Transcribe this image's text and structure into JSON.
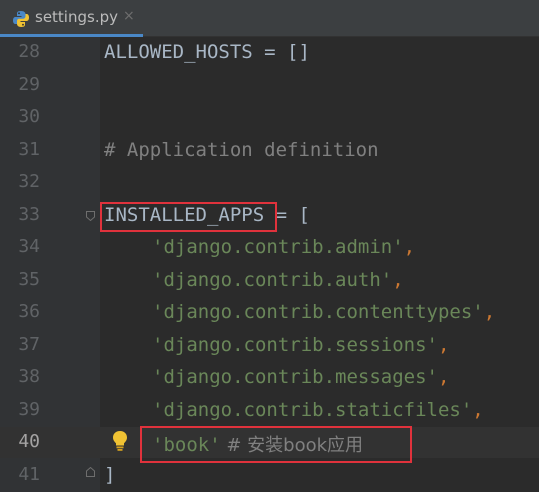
{
  "tab": {
    "filename": "settings.py",
    "close_glyph": "×",
    "icon": "python-file-icon"
  },
  "colors": {
    "editor_bg": "#2b2b2b",
    "gutter_bg": "#313335",
    "string": "#6a8759",
    "comment": "#808080",
    "punctuation": "#cc7832",
    "highlight_box": "#e0323c",
    "tab_underline": "#4a88c7"
  },
  "lines": [
    {
      "number": "28",
      "code": "ALLOWED_HOSTS = []"
    },
    {
      "number": "29",
      "code": ""
    },
    {
      "number": "30",
      "code": ""
    },
    {
      "number": "31",
      "code": "# Application definition"
    },
    {
      "number": "32",
      "code": ""
    },
    {
      "number": "33",
      "name": "INSTALLED_APPS",
      "rest": " = ["
    },
    {
      "number": "34",
      "string": "'django.contrib.admin'",
      "punc": ","
    },
    {
      "number": "35",
      "string": "'django.contrib.auth'",
      "punc": ","
    },
    {
      "number": "36",
      "string": "'django.contrib.contenttypes'",
      "punc": ","
    },
    {
      "number": "37",
      "string": "'django.contrib.sessions'",
      "punc": ","
    },
    {
      "number": "38",
      "string": "'django.contrib.messages'",
      "punc": ","
    },
    {
      "number": "39",
      "string": "'django.contrib.staticfiles'",
      "punc": ","
    },
    {
      "number": "40",
      "string": "'book'",
      "comment": " # 安装book应用"
    },
    {
      "number": "41",
      "code": "]"
    }
  ],
  "current_line": "40"
}
